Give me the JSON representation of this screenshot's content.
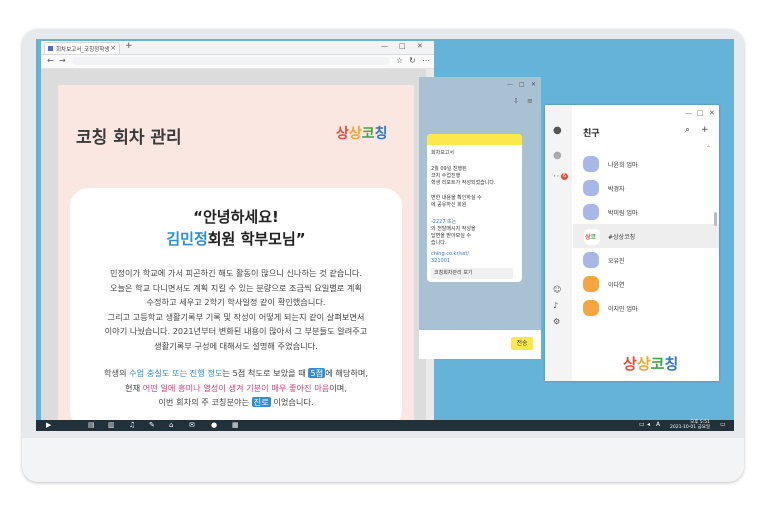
{
  "browser": {
    "tab_title": "회차보고서_코칭정학생",
    "page": {
      "title": "코칭 회차 관리",
      "logo": [
        "상",
        "상",
        "코",
        "칭"
      ],
      "greeting_line1": "“안녕하세요!",
      "greeting_name": "김민정",
      "greeting_rest": "회원 학부모님”",
      "paragraph1": [
        "민정이가 학교에 가서 피곤하긴 해도 활동이 많으니 신나하는 것 같습니다.",
        "오늘은 학교 다니면서도 계획 지킬 수 있는 분량으로 조금씩 요일별로 계획",
        "수정하고 세우고 2학기 학사일정 같이 확인했습니다.",
        "그리고 고등학교 생활기록부 기록 및 작성이 어떻게 되는지 같이 살펴보면서",
        "이야기 나눴습니다. 2021년부터 변화된 내용이 많아서 그 부분들도 알려주고",
        "생활기록부 구성에 대해서도 설명해 주었습니다."
      ],
      "p2_a": "학생의 ",
      "p2_hl1": "수업 충실도 또는 진행 정도",
      "p2_b": "는 5점 척도로 보았을 때 ",
      "p2_box": "5점",
      "p2_c": "에 해당하며,",
      "p3_a": "현재 ",
      "p3_hl": "어떤 일에 흥미나 열성이 생겨 기분이 매우 좋아진 마음",
      "p3_b": "이며,",
      "p4_a": "이번 회차의 주 코칭분야는 ",
      "p4_box": "진로",
      "p4_b": " 이었습니다."
    }
  },
  "chat": {
    "bubble_lines": [
      "회차보고서",
      "2월 09일 진행된",
      "코치 수업진행",
      "학생 리포트가 작성되었습니다.",
      "",
      "변한 내용을 확인하실 수",
      "에 공유하신 회원"
    ],
    "bubble_lines2": [
      "-2227 또는",
      "의 전달메시지 작성을",
      "답변을 받아보실 수",
      "습니다."
    ],
    "link": "ching.co.kr/sst/",
    "link2": "321001",
    "button": "코칭회차관리 보기",
    "send": "전송"
  },
  "friends": {
    "title": "친구",
    "items": [
      {
        "name": "나윤희 엄마",
        "color": "#a7b8e6"
      },
      {
        "name": "박경자",
        "color": "#a7b8e6"
      },
      {
        "name": "박미림 엄마",
        "color": "#a7b8e6"
      },
      {
        "name": "#상상코칭",
        "color": "#ffffff"
      },
      {
        "name": "오유진",
        "color": "#a7b8e6"
      },
      {
        "name": "이다연",
        "color": "#f4a640"
      },
      {
        "name": "이지민 엄마",
        "color": "#f4a640"
      }
    ],
    "badge": "6"
  },
  "taskbar": {
    "time": "오후 5:51",
    "date": "2021-10-01 금요일",
    "lang": "A"
  }
}
